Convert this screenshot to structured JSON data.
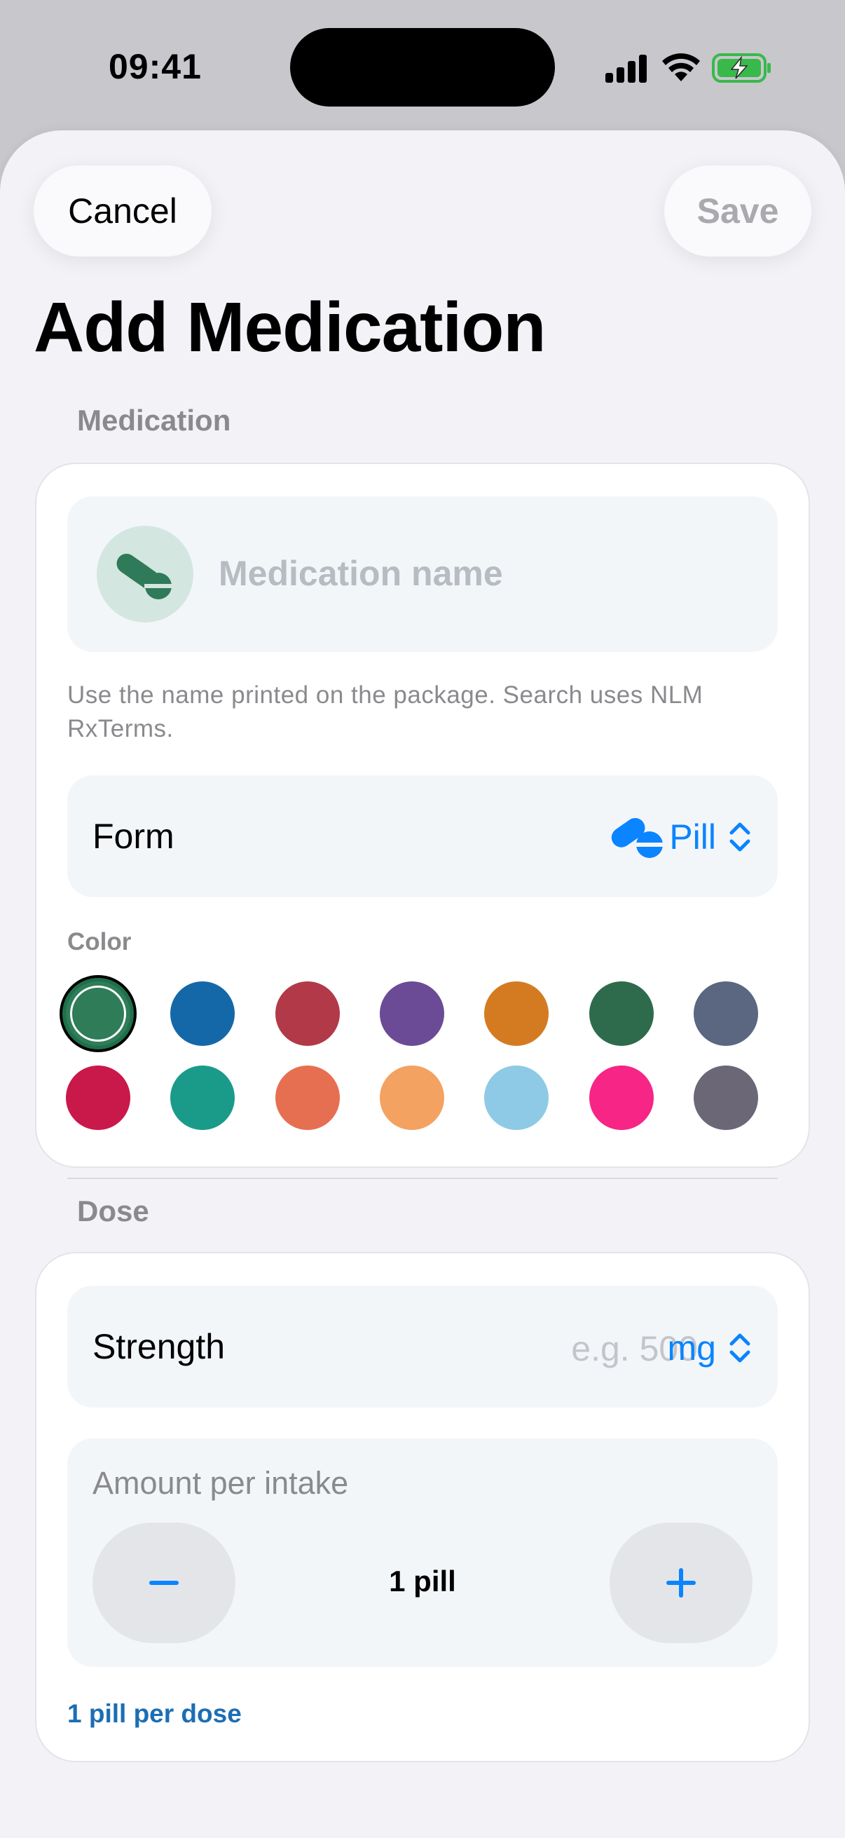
{
  "status_bar": {
    "time": "09:41",
    "icons": [
      "cellular-signal-icon",
      "wifi-icon",
      "battery-charging-icon"
    ]
  },
  "nav": {
    "cancel_label": "Cancel",
    "save_label": "Save"
  },
  "title": "Add Medication",
  "medication_section": {
    "header": "Medication",
    "name_placeholder": "Medication name",
    "name_value": "",
    "helper_text": "Use the name printed on the package. Search uses NLM RxTerms.",
    "form_label": "Form",
    "form_value": "Pill",
    "form_icon": "pill-icon",
    "color_label": "Color",
    "colors": [
      "#2e7d58",
      "#1468a8",
      "#b23a48",
      "#6b4b96",
      "#d47b22",
      "#2e6b4d",
      "#5b6680",
      "#c9184a",
      "#1a9b8a",
      "#e76f51",
      "#f4a261",
      "#8ecae6",
      "#f72585",
      "#6b6776"
    ],
    "selected_color": "#2e7d58"
  },
  "dose_section": {
    "header": "Dose",
    "strength_label": "Strength",
    "strength_placeholder": "e.g. 500",
    "strength_value": "",
    "unit_value": "mg",
    "amount_label": "Amount per intake",
    "amount_value": "1 pill",
    "decrement_icon": "minus-icon",
    "increment_icon": "plus-icon",
    "summary": "1 pill per dose"
  },
  "accent_color": "#0a84ff"
}
